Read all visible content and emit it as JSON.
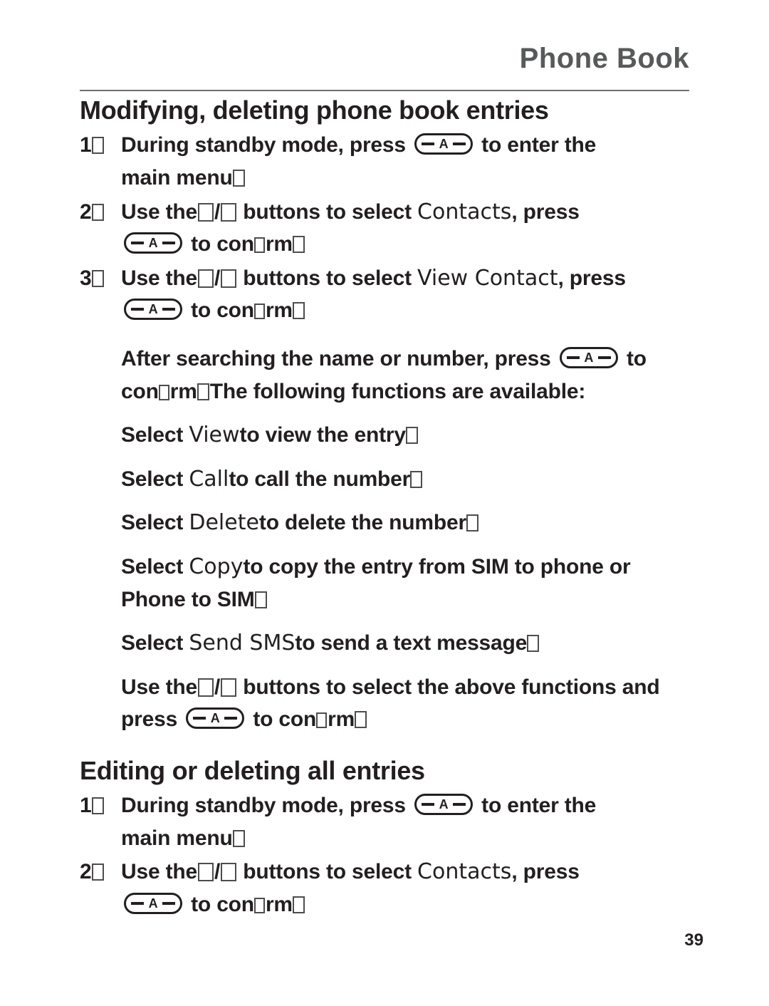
{
  "header": {
    "title": "Phone Book"
  },
  "sections": [
    {
      "title": "Modifying, deleting phone book entries"
    },
    {
      "title": "Editing or deleting all entries"
    }
  ],
  "body": {
    "s1_step1_num": "1",
    "s1_step1_a": "During standby mode, press",
    "s1_step1_b": "to enter the",
    "s1_step1_c": "main menu",
    "s1_step2_num": "2",
    "s1_step2_a": "Use the",
    "s1_step2_slash": "/",
    "s1_step2_b": "buttons to select",
    "s1_step2_ui": "Contacts",
    "s1_step2_c": ", press",
    "s1_step2_d": "to con",
    "s1_step2_e": "rm",
    "s1_step3_num": "3",
    "s1_step3_a": "Use the",
    "s1_step3_slash": "/",
    "s1_step3_b": "buttons to select",
    "s1_step3_ui": "View Contact",
    "s1_step3_c": ", press",
    "s1_step3_d": "to con",
    "s1_step3_e": "rm",
    "p_after_a": "After searching the name or number, press",
    "p_after_b": "to",
    "p_after_c": "con",
    "p_after_d": "rm",
    "p_after_e": "The following functions are available:",
    "p_view_a": "Select",
    "p_view_ui": "View",
    "p_view_b": "to view the entry",
    "p_call_a": "Select",
    "p_call_ui": "Call",
    "p_call_b": "to call the number",
    "p_delete_a": "Select",
    "p_delete_ui": "Delete",
    "p_delete_b": "to delete the number",
    "p_copy_a": "Select",
    "p_copy_ui": "Copy",
    "p_copy_b": "to copy the entry from SIM to phone or",
    "p_copy_c": "Phone to SIM",
    "p_sms_a": "Select",
    "p_sms_ui": "Send SMS",
    "p_sms_b": "to send a text message",
    "p_use_a": "Use the",
    "p_use_slash": "/",
    "p_use_b": "buttons to select the above functions and",
    "p_use_c": "press",
    "p_use_d": "to con",
    "p_use_e": "rm",
    "s2_step1_num": "1",
    "s2_step1_a": "During standby mode, press",
    "s2_step1_b": "to enter the",
    "s2_step1_c": "main menu",
    "s2_step2_num": "2",
    "s2_step2_a": "Use the",
    "s2_step2_slash": "/",
    "s2_step2_b": "buttons to select",
    "s2_step2_ui": "Contacts",
    "s2_step2_c": ", press",
    "s2_step2_d": "to con",
    "s2_step2_e": "rm"
  },
  "footer": {
    "page_number": "39"
  },
  "icons": {
    "ok_key": "ok-menu-key-icon",
    "nav_up": "nav-up-key-icon",
    "nav_down": "nav-down-key-icon"
  },
  "colors": {
    "header_gray": "#58595b",
    "text_black": "#231f20"
  }
}
